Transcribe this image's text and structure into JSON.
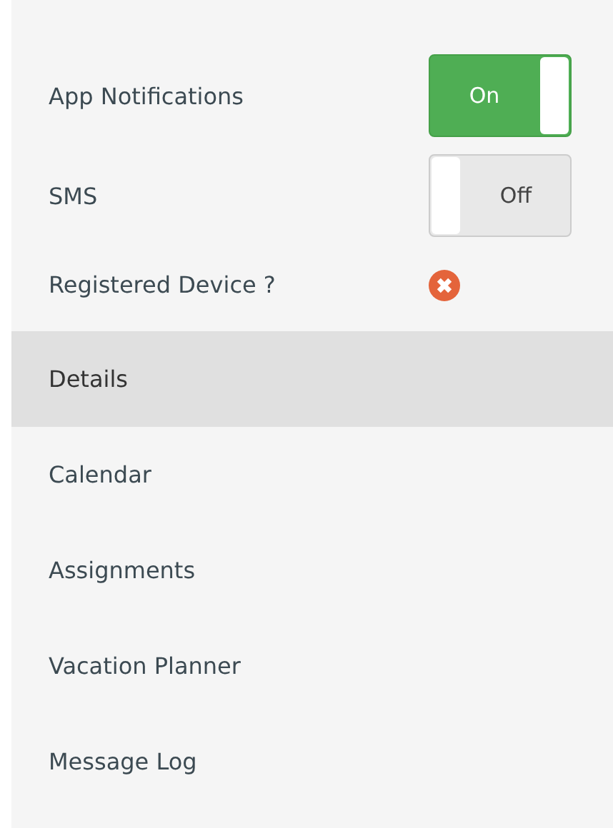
{
  "settings": [
    {
      "kind": "toggle",
      "label": "App Notifications",
      "on": true,
      "state_text": "On"
    },
    {
      "kind": "toggle",
      "label": "SMS",
      "on": false,
      "state_text": "Off"
    },
    {
      "kind": "status",
      "label": "Registered Device ?",
      "registered": false
    }
  ],
  "menu": [
    {
      "label": "Details",
      "selected": true
    },
    {
      "label": "Calendar",
      "selected": false
    },
    {
      "label": "Assignments",
      "selected": false
    },
    {
      "label": "Vacation Planner",
      "selected": false
    },
    {
      "label": "Message Log",
      "selected": false
    }
  ]
}
